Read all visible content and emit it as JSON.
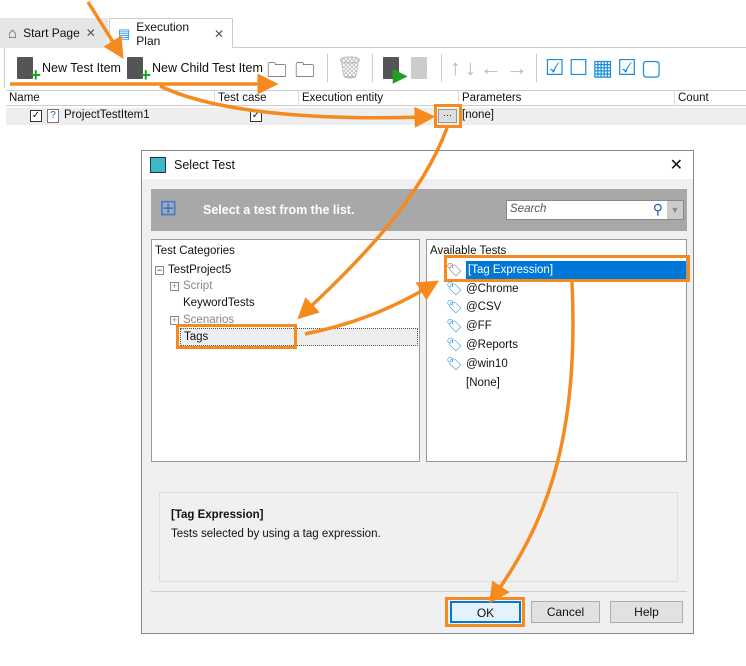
{
  "tabs": [
    {
      "label": "Start Page"
    },
    {
      "label": "Execution Plan"
    }
  ],
  "toolbar": {
    "new_test_item": "New Test Item",
    "new_child_test_item": "New Child Test Item"
  },
  "grid": {
    "columns": [
      "Name",
      "Test case",
      "Execution entity",
      "Parameters",
      "Count"
    ],
    "row": {
      "name": "ProjectTestItem1",
      "ellipsis": "···",
      "parameters": "[none]"
    }
  },
  "dialog": {
    "title": "Select Test",
    "banner": "Select a test from the list.",
    "search_placeholder": "Search",
    "categories_header": "Test Categories",
    "tree": {
      "root": "TestProject5",
      "items": [
        "Script",
        "KeywordTests",
        "Scenarios",
        "Tags"
      ]
    },
    "available_header": "Available Tests",
    "tests": [
      "[Tag Expression]",
      "@Chrome",
      "@CSV",
      "@FF",
      "@Reports",
      "@win10",
      "[None]"
    ],
    "desc_title": "[Tag Expression]",
    "desc_text": "Tests selected by using a tag expression.",
    "ok": "OK",
    "cancel": "Cancel",
    "help": "Help"
  },
  "colors": {
    "accent": "#f58a1f",
    "selection": "#0078d7"
  }
}
